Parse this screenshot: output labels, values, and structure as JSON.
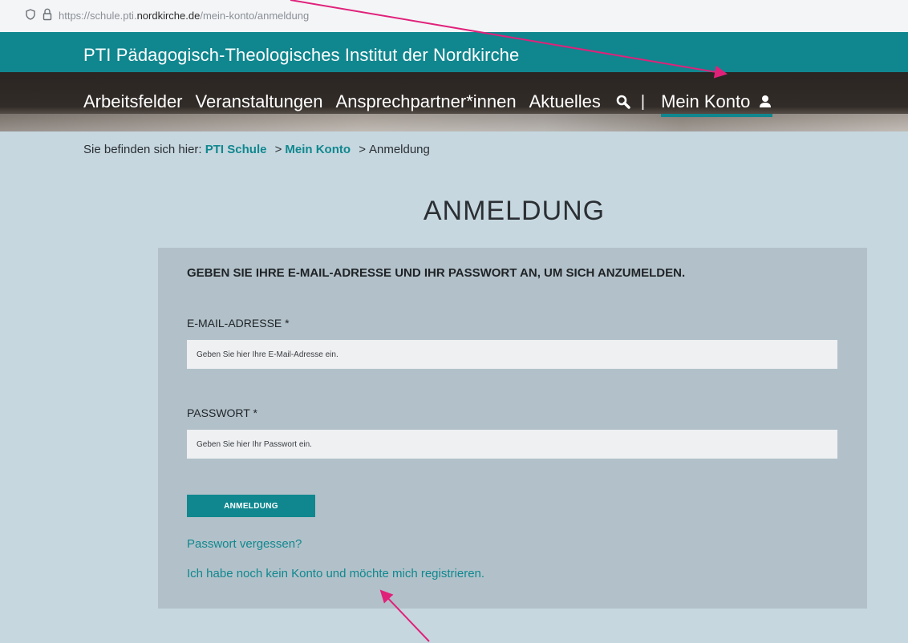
{
  "browser": {
    "url_prefix": "https://schule.pti.",
    "url_domain": "nordkirche.de",
    "url_path": "/mein-konto/anmeldung"
  },
  "header": {
    "site_title": "PTI Pädagogisch-Theologisches Institut der Nordkirche"
  },
  "nav": {
    "items": [
      "Arbeitsfelder",
      "Veranstaltungen",
      "Ansprechpartner*innen",
      "Aktuelles"
    ],
    "divider": "|",
    "account_label": "Mein Konto"
  },
  "breadcrumb": {
    "prefix": "Sie befinden sich hier:",
    "crumbs": [
      "PTI Schule",
      "Mein Konto",
      "Anmeldung"
    ],
    "separator": ">"
  },
  "page": {
    "title": "ANMELDUNG"
  },
  "login": {
    "instruction": "GEBEN SIE IHRE E-MAIL-ADRESSE UND IHR PASSWORT AN, UM SICH ANZUMELDEN.",
    "email_label": "E-MAIL-ADRESSE *",
    "email_placeholder": "Geben Sie hier Ihre E-Mail-Adresse ein.",
    "email_value": "",
    "password_label": "PASSWORT *",
    "password_placeholder": "Geben Sie hier Ihr Passwort ein.",
    "password_value": "",
    "submit_label": "ANMELDUNG",
    "forgot_link": "Passwort vergessen?",
    "register_link": "Ich habe noch kein Konto und möchte mich registrieren."
  },
  "colors": {
    "accent": "#10878f",
    "page_background": "#c6d7df",
    "box_background": "#b2c1c9",
    "annotation_arrow": "#e0217a"
  },
  "icons": [
    "shield-icon",
    "lock-icon",
    "search-icon",
    "user-icon",
    "annotation-arrow"
  ]
}
